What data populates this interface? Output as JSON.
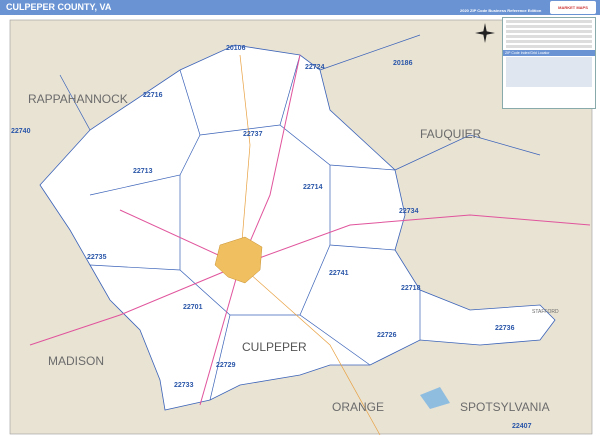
{
  "header": {
    "title": "CULPEPER COUNTY, VA",
    "subtitle": "2020 ZIP Code Business Reference Edition",
    "logo": "MARKET MAPS"
  },
  "legend": {
    "zip_index_title": "ZIP Code Index/Grid Locator"
  },
  "counties": [
    "RAPPAHANNOCK",
    "FAUQUIER",
    "MADISON",
    "CULPEPER",
    "ORANGE",
    "SPOTSYLVANIA",
    "STAFFORD"
  ],
  "zips": [
    "20106",
    "22724",
    "20186",
    "22716",
    "22740",
    "22737",
    "22713",
    "22714",
    "22734",
    "22735",
    "22741",
    "22718",
    "22701",
    "22726",
    "22736",
    "22729",
    "22733",
    "22407"
  ],
  "colors": {
    "header": "#6a93d4",
    "land": "#e9e3d4",
    "county": "#ffffff",
    "city": "#f0c060",
    "zip_border": "#3b63b8",
    "highway": "#e0549c"
  }
}
